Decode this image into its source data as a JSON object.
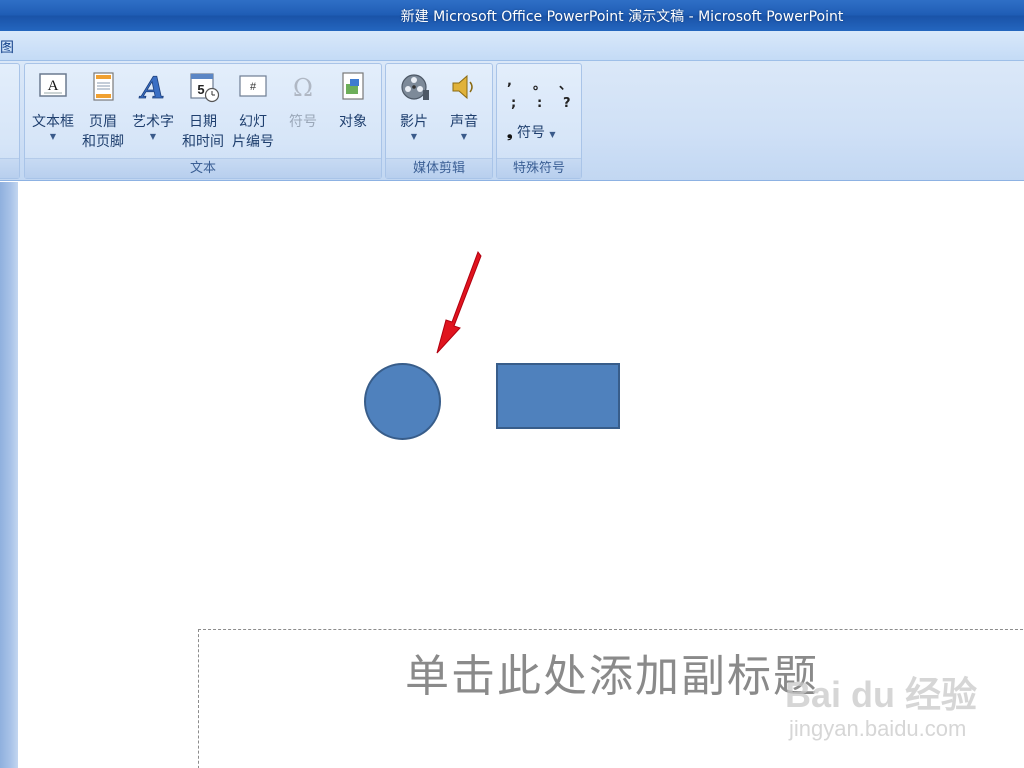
{
  "window": {
    "title": "新建 Microsoft Office PowerPoint 演示文稿 - Microsoft PowerPoint"
  },
  "menu": {
    "tabs": [
      {
        "label": "图"
      }
    ]
  },
  "ribbon": {
    "groups": [
      {
        "label": "文本",
        "buttons": [
          {
            "label": "文本框",
            "icon": "textbox-icon",
            "has_dropdown": true
          },
          {
            "label": "页眉",
            "label2": "和页脚",
            "icon": "header-footer-icon",
            "has_dropdown": false
          },
          {
            "label": "艺术字",
            "icon": "wordart-icon",
            "has_dropdown": true
          },
          {
            "label": "日期",
            "label2": "和时间",
            "icon": "date-time-icon",
            "has_dropdown": false
          },
          {
            "label": "幻灯",
            "label2": "片编号",
            "icon": "slide-number-icon",
            "has_dropdown": false
          },
          {
            "label": "符号",
            "icon": "omega-icon",
            "has_dropdown": false,
            "disabled": true
          },
          {
            "label": "对象",
            "icon": "object-icon",
            "has_dropdown": false
          }
        ]
      },
      {
        "label": "媒体剪辑",
        "buttons": [
          {
            "label": "影片",
            "icon": "film-reel-icon",
            "has_dropdown": true
          },
          {
            "label": "声音",
            "icon": "speaker-icon",
            "has_dropdown": true
          }
        ]
      },
      {
        "label": "特殊符号",
        "symbols_row1": [
          ",",
          "。",
          "、"
        ],
        "symbols_row2": [
          ";",
          ":",
          "?"
        ],
        "button": {
          "label": "符号",
          "icon": "comma-symbol-icon",
          "has_dropdown": true
        }
      }
    ]
  },
  "slide": {
    "shapes": [
      {
        "type": "circle",
        "fill": "#4f81bd",
        "stroke": "#385d8a"
      },
      {
        "type": "rectangle",
        "fill": "#4f81bd",
        "stroke": "#385d8a"
      }
    ],
    "annotation": {
      "type": "arrow",
      "color": "#e0141e"
    },
    "subtitle_placeholder": "单击此处添加副标题"
  },
  "watermark": {
    "brand": "Bai du 经验",
    "url": "jingyan.baidu.com"
  },
  "colors": {
    "title_bar": "#1f5db5",
    "ribbon": "#d6e5f8",
    "shape_fill": "#4f81bd",
    "arrow": "#e0141e"
  }
}
